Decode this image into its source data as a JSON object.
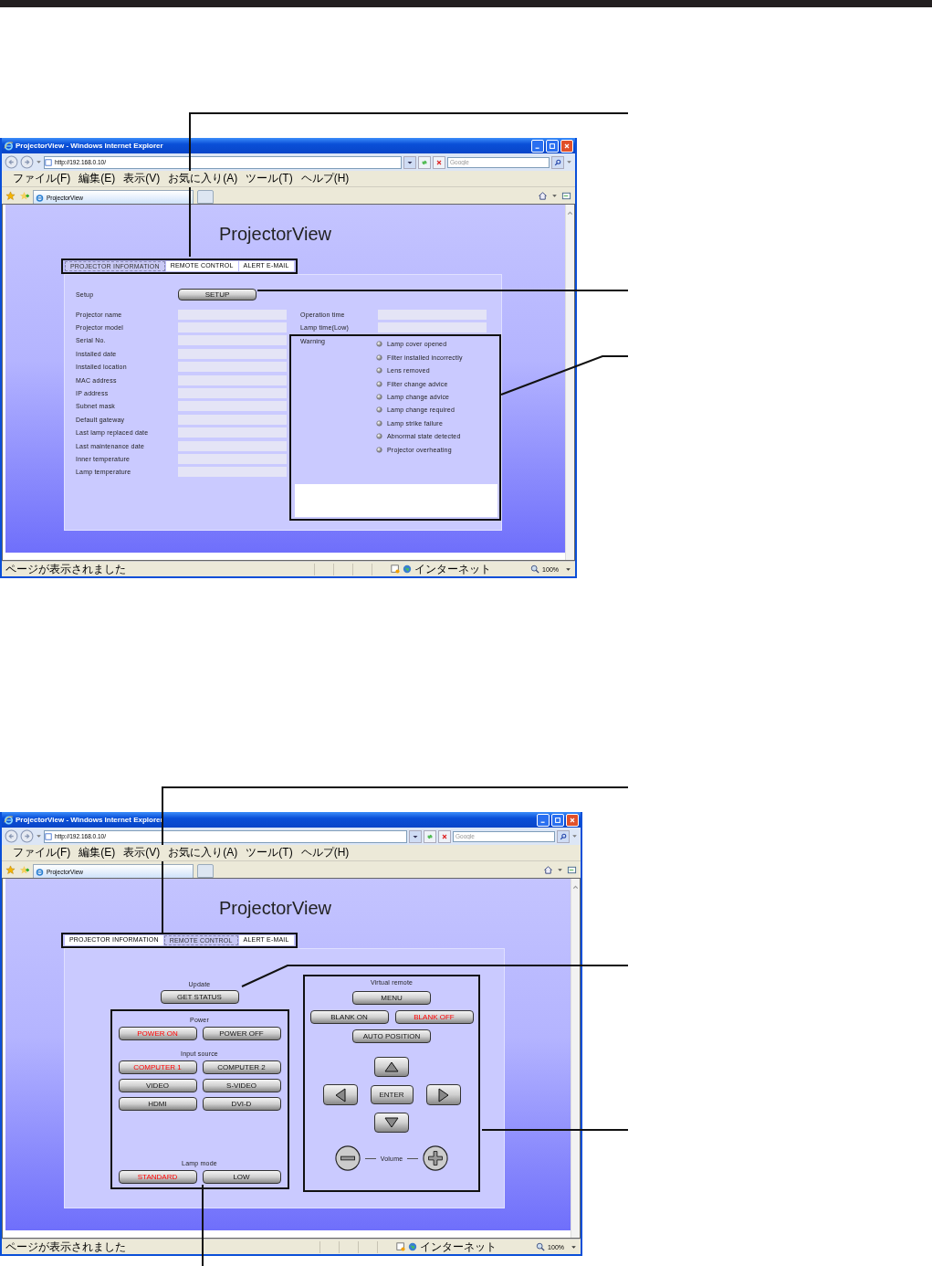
{
  "screens": [
    {
      "kind": "info",
      "browser": {
        "title": "ProjectorView - Windows Internet Explorer",
        "url": "http://192.168.0.10/",
        "search_placeholder": "Google",
        "menu": [
          "ファイル(F)",
          "編集(E)",
          "表示(V)",
          "お気に入り(A)",
          "ツール(T)",
          "ヘルプ(H)"
        ],
        "tab": "ProjectorView",
        "status": "ページが表示されました",
        "zone": "インターネット",
        "zoom": "100%"
      },
      "page": {
        "title": "ProjectorView",
        "tabs": [
          {
            "label": "PROJECTOR INFORMATION",
            "selected": true
          },
          {
            "label": "REMOTE CONTROL",
            "selected": false
          },
          {
            "label": "ALERT E-MAIL",
            "selected": false
          }
        ],
        "setup_label": "Setup",
        "setup_button": "SETUP",
        "fields_left": [
          "Projector name",
          "Projector model",
          "Serial No.",
          "Installed date",
          "Installed location",
          "MAC address",
          "IP address",
          "Subnet mask",
          "Default gateway",
          "Last lamp replaced date",
          "Last maintenance date",
          "Inner temperature",
          "Lamp temperature"
        ],
        "fields_right": [
          "Operation time",
          "Lamp time(Low)"
        ],
        "warning_label": "Warning",
        "warnings": [
          "Lamp cover opened",
          "Filter installed incorrectly",
          "Lens removed",
          "Filter change advice",
          "Lamp change advice",
          "Lamp change required",
          "Lamp strike failure",
          "Abnormal state detected",
          "Projector overheating"
        ]
      }
    },
    {
      "kind": "remote",
      "browser": {
        "title": "ProjectorView - Windows Internet Explorer",
        "url": "http://192.168.0.10/",
        "search_placeholder": "Google",
        "menu": [
          "ファイル(F)",
          "編集(E)",
          "表示(V)",
          "お気に入り(A)",
          "ツール(T)",
          "ヘルプ(H)"
        ],
        "tab": "ProjectorView",
        "status": "ページが表示されました",
        "zone": "インターネット",
        "zoom": "100%"
      },
      "page": {
        "title": "ProjectorView",
        "tabs": [
          {
            "label": "PROJECTOR INFORMATION",
            "selected": false
          },
          {
            "label": "REMOTE CONTROL",
            "selected": true
          },
          {
            "label": "ALERT E-MAIL",
            "selected": false
          }
        ],
        "update_label": "Update",
        "get_status": "GET STATUS",
        "power": {
          "label": "Power",
          "buttons": [
            {
              "label": "POWER ON",
              "active": true
            },
            {
              "label": "POWER OFF",
              "active": false
            }
          ]
        },
        "input": {
          "label": "Input source",
          "buttons": [
            {
              "label": "COMPUTER 1",
              "active": true
            },
            {
              "label": "COMPUTER 2",
              "active": false
            },
            {
              "label": "VIDEO",
              "active": false
            },
            {
              "label": "S-VIDEO",
              "active": false
            },
            {
              "label": "HDMI",
              "active": false
            },
            {
              "label": "DVI-D",
              "active": false
            }
          ]
        },
        "lamp": {
          "label": "Lamp mode",
          "buttons": [
            {
              "label": "STANDARD",
              "active": true
            },
            {
              "label": "LOW",
              "active": false
            }
          ]
        },
        "remote": {
          "label": "Virtual remote",
          "rows": [
            [
              {
                "label": "MENU",
                "active": false
              }
            ],
            [
              {
                "label": "BLANK ON",
                "active": false
              },
              {
                "label": "BLANK OFF",
                "active": true
              }
            ],
            [
              {
                "label": "AUTO POSITION",
                "active": false
              }
            ]
          ],
          "enter": "ENTER",
          "volume_label": "Volume"
        }
      }
    }
  ]
}
